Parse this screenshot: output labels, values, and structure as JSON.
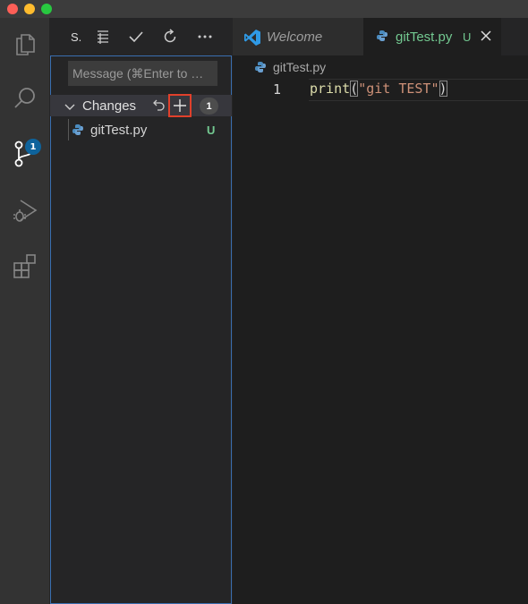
{
  "window": {
    "traffic_lights": [
      "close",
      "minimize",
      "zoom"
    ]
  },
  "activity_bar": {
    "items": [
      "explorer-icon",
      "search-icon",
      "source-control-icon",
      "run-debug-icon",
      "extensions-icon"
    ],
    "source_control_badge": "1"
  },
  "sidebar": {
    "title": "S.",
    "toolbar": [
      "tree-view-icon",
      "commit-check-icon",
      "refresh-icon",
      "more-icon"
    ],
    "message_placeholder": "Message (⌘Enter to …",
    "changes": {
      "label": "Changes",
      "count": "1",
      "files": [
        {
          "name": "gitTest.py",
          "status": "U"
        }
      ]
    }
  },
  "tabs": [
    {
      "label": "Welcome",
      "icon": "vscode-logo-icon",
      "active": false
    },
    {
      "label": "gitTest.py",
      "status": "U",
      "icon": "python-icon",
      "active": true
    }
  ],
  "editor": {
    "breadcrumb": "gitTest.py",
    "lines": [
      {
        "number": "1",
        "fn": "print",
        "open": "(",
        "string": "\"git TEST\"",
        "close": ")"
      }
    ]
  },
  "colors": {
    "accent": "#0e639c",
    "untracked": "#73c991",
    "highlight_border": "#e0402b",
    "focus_border": "#3a6fb0"
  }
}
